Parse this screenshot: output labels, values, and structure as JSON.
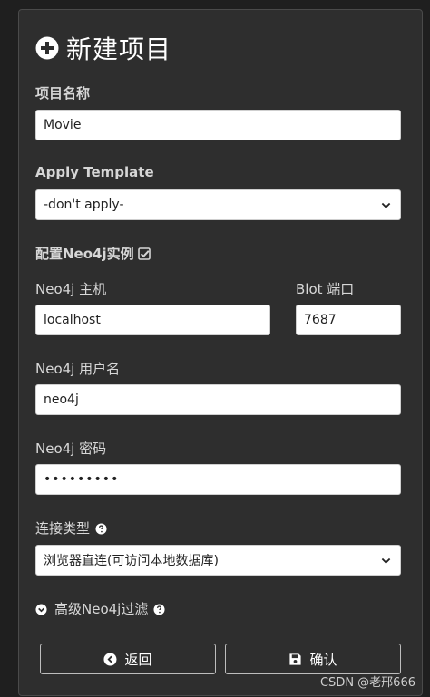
{
  "header": {
    "title": "新建项目",
    "icon": "plus-circle-icon"
  },
  "form": {
    "project_name": {
      "label": "项目名称",
      "value": "Movie"
    },
    "apply_template": {
      "label": "Apply Template",
      "value": "-don't apply-"
    },
    "configure": {
      "label": "配置Neo4j实例",
      "checked": true
    },
    "host": {
      "label": "Neo4j 主机",
      "value": "localhost"
    },
    "bolt_port": {
      "label": "Blot 端口",
      "value": "7687"
    },
    "username": {
      "label": "Neo4j 用户名",
      "value": "neo4j"
    },
    "password": {
      "label": "Neo4j 密码",
      "value": "•••••••••"
    },
    "connection_type": {
      "label": "连接类型",
      "value": "浏览器直连(可访问本地数据库)"
    },
    "advanced_filter": {
      "label": "高级Neo4j过滤"
    }
  },
  "buttons": {
    "back": "返回",
    "confirm": "确认"
  },
  "watermark": "CSDN @老邢666",
  "colors": {
    "panel": "#2e2e2e",
    "background": "#1f1f1f",
    "text": "#ffffff"
  }
}
